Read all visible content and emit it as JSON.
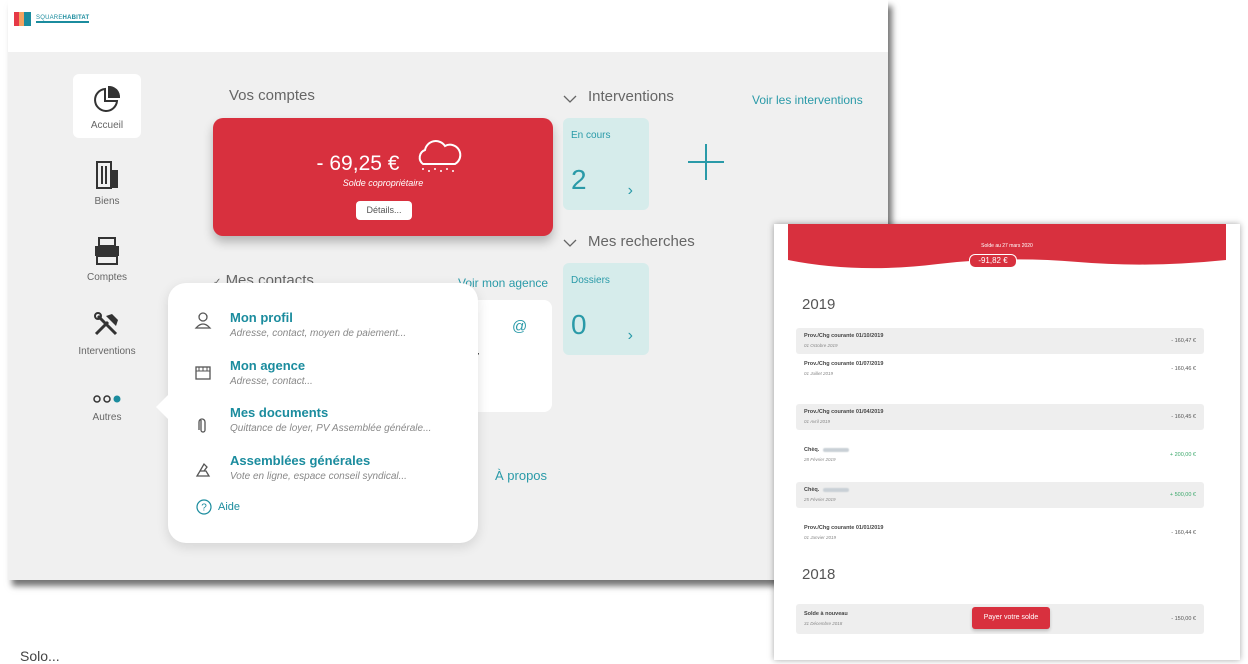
{
  "logo": {
    "text_a": "SQUARE",
    "text_b": "HABITAT"
  },
  "sidebar": {
    "items": [
      {
        "label": "Accueil",
        "icon": "pie-chart-icon"
      },
      {
        "label": "Biens",
        "icon": "building-icon"
      },
      {
        "label": "Comptes",
        "icon": "printer-icon"
      },
      {
        "label": "Interventions",
        "icon": "tools-icon"
      },
      {
        "label": "Autres",
        "icon": "dots-icon"
      }
    ]
  },
  "comptes": {
    "heading": "Vos comptes",
    "amount": "- 69,25 €",
    "subtitle": "Solde copropriétaire",
    "details_button": "Détails..."
  },
  "interventions": {
    "heading": "Interventions",
    "link": "Voir les interventions",
    "tile_label": "En cours",
    "tile_count": "2"
  },
  "recherches": {
    "heading": "Mes recherches",
    "tile_label": "Dossiers",
    "tile_count": "0"
  },
  "contacts": {
    "heading": "Mes contacts",
    "link": "Voir mon agence",
    "partial_letter": "r"
  },
  "apropos": "À propos",
  "menu": {
    "items": [
      {
        "title": "Mon profil",
        "subtitle": "Adresse, contact, moyen de paiement..."
      },
      {
        "title": "Mon agence",
        "subtitle": "Adresse, contact..."
      },
      {
        "title": "Mes documents",
        "subtitle": "Quittance de loyer, PV Assemblée générale..."
      },
      {
        "title": "Assemblées générales",
        "subtitle": "Vote en ligne, espace conseil syndical..."
      }
    ],
    "aide": "Aide"
  },
  "transactions": {
    "banner_label": "Solde au 27 mars 2020",
    "banner_amount": "-91,82 €",
    "years": [
      {
        "year": "2019",
        "rows": [
          {
            "title": "Prov./Chg courante 01/10/2019",
            "date": "01 Octobre 2019",
            "amount": "- 160,47 €",
            "positive": false
          },
          {
            "title": "Prov./Chg courante 01/07/2019",
            "date": "01 Juillet 2019",
            "amount": "- 160,46 €",
            "positive": false
          },
          {
            "title": "Prov./Chg courante 01/04/2019",
            "date": "01 Avril 2019",
            "amount": "- 160,45 €",
            "positive": false
          },
          {
            "title": "Chèq.",
            "date": "28 Février 2019",
            "amount": "+ 200,00 €",
            "positive": true
          },
          {
            "title": "Chèq.",
            "date": "25 Février 2019",
            "amount": "+ 500,00 €",
            "positive": true
          },
          {
            "title": "Prov./Chg courante 01/01/2019",
            "date": "01 Janvier 2019",
            "amount": "- 160,44 €",
            "positive": false
          }
        ]
      },
      {
        "year": "2018",
        "rows": [
          {
            "title": "Solde à nouveau",
            "date": "31 Décembre 2018",
            "amount": "- 150,00 €",
            "positive": false
          }
        ]
      }
    ],
    "pay_button": "Payer votre solde"
  },
  "caption": "Solo..."
}
